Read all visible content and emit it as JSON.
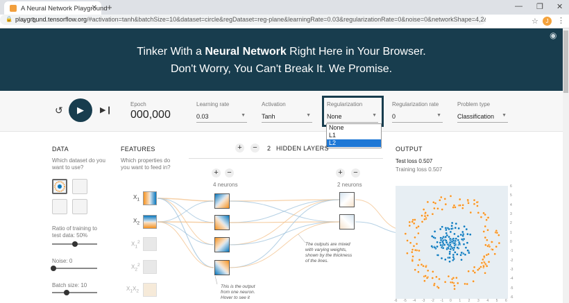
{
  "browser": {
    "tab_title": "A Neural Network Playground",
    "url_domain": "playground.tensorflow.org",
    "url_rest": "/#activation=tanh&batchSize=10&dataset=circle&regDataset=reg-plane&learningRate=0.03&regularizationRate=0&noise=0&networkShape=4,2&se...",
    "avatar_letter": "J"
  },
  "hero": {
    "line1_pre": "Tinker With a ",
    "line1_bold": "Neural Network",
    "line1_post": " Right Here in Your Browser.",
    "line2": "Don't Worry, You Can't Break It. We Promise."
  },
  "controls": {
    "epoch_label": "Epoch",
    "epoch_value": "000,000",
    "learning_rate_label": "Learning rate",
    "learning_rate_value": "0.03",
    "activation_label": "Activation",
    "activation_value": "Tanh",
    "regularization_label": "Regularization",
    "regularization_value": "None",
    "regularization_options": [
      "None",
      "L1",
      "L2"
    ],
    "regularization_highlighted": "L2",
    "reg_rate_label": "Regularization rate",
    "reg_rate_value": "0",
    "problem_type_label": "Problem type",
    "problem_type_value": "Classification"
  },
  "data_panel": {
    "title": "DATA",
    "subtitle": "Which dataset do you want to use?",
    "ratio_label": "Ratio of training to test data:  50%",
    "ratio": 0.5,
    "noise_label": "Noise:  0",
    "noise": 0,
    "batch_label": "Batch size:  10",
    "batch": 10
  },
  "features_panel": {
    "title": "FEATURES",
    "subtitle": "Which properties do you want to feed in?",
    "features": [
      "X1",
      "X2",
      "X1²",
      "X2²",
      "X1X2"
    ]
  },
  "network": {
    "hidden_layers_count": "2",
    "hidden_layers_label": "HIDDEN LAYERS",
    "layer1_label": "4 neurons",
    "layer2_label": "2 neurons",
    "note_neuron": "This is the output from one neuron. Hover to see it",
    "note_weights": "The outputs are mixed with varying weights, shown by the thickness of the lines."
  },
  "output_panel": {
    "title": "OUTPUT",
    "test_loss": "Test loss 0.507",
    "training_loss": "Training loss 0.507",
    "y_ticks": [
      "6",
      "5",
      "4",
      "3",
      "2",
      "1",
      "0",
      "-1",
      "-2",
      "-3",
      "-4",
      "-5",
      "-6"
    ],
    "x_ticks": [
      "-6",
      "-5",
      "-4",
      "-3",
      "-2",
      "-1",
      "0",
      "1",
      "2",
      "3",
      "4",
      "5",
      "6"
    ]
  },
  "colors": {
    "header_bg": "#183d4e",
    "orange": "#f59322",
    "blue": "#0877bd",
    "highlight": "#1e78d6"
  }
}
